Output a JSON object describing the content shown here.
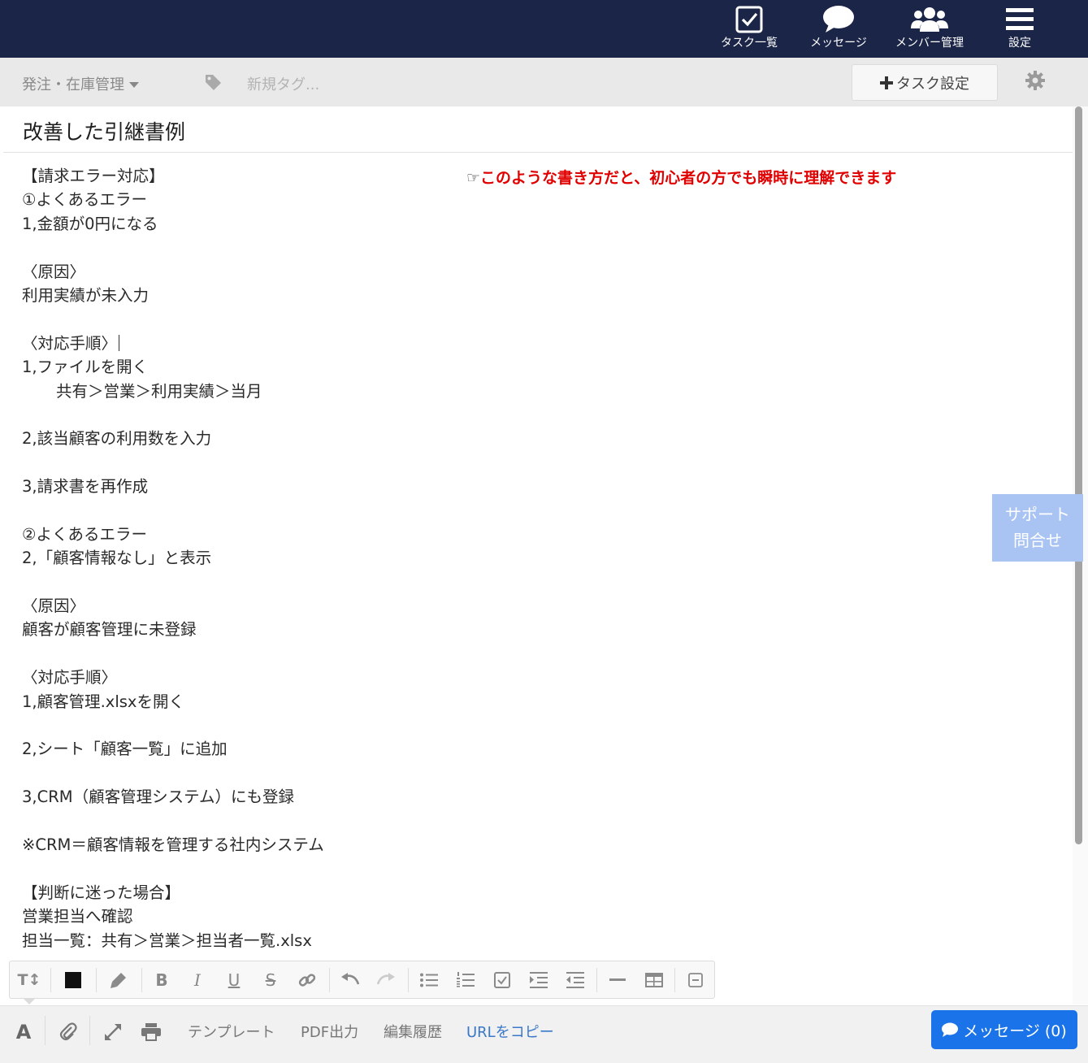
{
  "nav": {
    "tasks_label": "タスク一覧",
    "messages_label": "メッセージ",
    "members_label": "メンバー管理",
    "settings_label": "設定"
  },
  "subbar": {
    "category": "発注・在庫管理",
    "tag_placeholder": "新規タグ...",
    "task_settings_label": "タスク設定"
  },
  "document": {
    "title": "改善した引継書例",
    "note_hand": "☞",
    "note": "このような書き方だと、初心者の方でも瞬時に理解できます",
    "lines": [
      "【請求エラー対応】",
      "①よくあるエラー",
      "1,金額が0円になる",
      "",
      "〈原因〉",
      "利用実績が未入力",
      "",
      "〈対応手順〉",
      "1,ファイルを開く",
      "共有＞営業＞利用実績＞当月",
      "",
      "2,該当顧客の利用数を入力",
      "",
      "3,請求書を再作成",
      "",
      "②よくあるエラー",
      "2,「顧客情報なし」と表示",
      "",
      "〈原因〉",
      "顧客が顧客管理に未登録",
      "",
      "〈対応手順〉",
      "1,顧客管理.xlsxを開く",
      "",
      "2,シート「顧客一覧」に追加",
      "",
      "3,CRM（顧客管理システム）にも登録",
      "",
      "※CRM＝顧客情報を管理する社内システム",
      "",
      "【判断に迷った場合】",
      "営業担当へ確認",
      "担当一覧：共有＞営業＞担当者一覧.xlsx"
    ]
  },
  "support": {
    "line1": "サポート",
    "line2": "問合せ"
  },
  "toolbar": {
    "font_size_glyph": "T↕",
    "bold_glyph": "B",
    "italic_glyph": "I",
    "underline_glyph": "U",
    "strike_glyph": "S"
  },
  "bottom": {
    "text_glyph": "A",
    "template_label": "テンプレート",
    "pdf_label": "PDF出力",
    "history_label": "編集履歴",
    "copy_url_label": "URLをコピー",
    "message_button_label": "メッセージ (0)"
  }
}
